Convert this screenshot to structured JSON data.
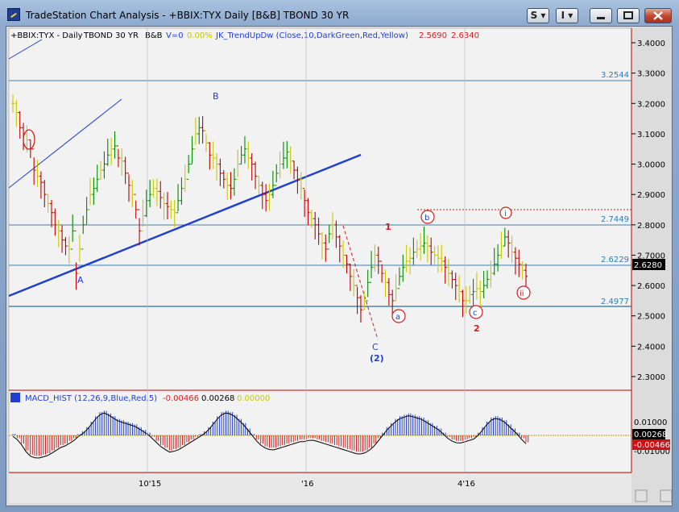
{
  "window": {
    "title": "TradeStation Chart Analysis - +BBIX:TYX Daily [B&B] TBOND 30 YR",
    "btn_s": "S ▾",
    "btn_i": "I ▾",
    "btn_min_icon": "minimize-icon",
    "btn_max_icon": "maximize-icon",
    "btn_close_icon": "close-icon"
  },
  "price_header": {
    "symbol": "+BBIX:TYX - Daily",
    "desc": "TBOND 30 YR",
    "bb": "B&B",
    "volume": "V=0",
    "pct": "0.00%",
    "indicator": "JK_TrendUpDw (Close,10,DarkGreen,Red,Yellow)",
    "val1": "2.5690",
    "val2": "2.6340"
  },
  "macd_header": {
    "name": "MACD_HIST (12,26,9,Blue,Red,5)",
    "val1": "-0.00466",
    "val2": "0.00268",
    "val3": "0.00000"
  },
  "y_axis": {
    "ticks": [
      "3.4000",
      "3.3000",
      "3.2000",
      "3.1000",
      "3.0000",
      "2.9000",
      "2.8000",
      "2.7000",
      "2.6000",
      "2.5000",
      "2.4000",
      "2.3000"
    ],
    "last_price": "2.6280"
  },
  "macd_axis": {
    "ticks": [
      "0.01000",
      "-0.01000"
    ],
    "signal_label": "0.00268",
    "hist_label": "-0.00466"
  },
  "x_axis": {
    "ticks": [
      "10'15",
      "'16",
      "4'16"
    ]
  },
  "levels": [
    "3.2544",
    "2.7449",
    "2.6229",
    "2.4977"
  ],
  "wave_labels": {
    "A": "A",
    "B": "B",
    "C": "C",
    "two_big": "(2)",
    "one": "1",
    "two": "2",
    "a": "a",
    "b": "b",
    "c": "c",
    "i": "i",
    "ii": "ii"
  },
  "chart_data": {
    "type": "ohlc",
    "series": [
      {
        "name": "+BBIX:TYX - Daily",
        "values": [
          3.2,
          3.17,
          3.12,
          3.1,
          3.08,
          3.05,
          2.98,
          2.96,
          2.94,
          2.9,
          2.87,
          2.84,
          2.8,
          2.78,
          2.75,
          2.73,
          2.72,
          2.78,
          2.64,
          2.72,
          2.8,
          2.85,
          2.9,
          2.92,
          2.95,
          2.98,
          3.0,
          3.03,
          3.05,
          3.06,
          3.02,
          3.01,
          2.97,
          2.93,
          2.9,
          2.85,
          2.78,
          2.83,
          2.88,
          2.9,
          2.92,
          2.91,
          2.89,
          2.87,
          2.86,
          2.85,
          2.84,
          2.88,
          2.92,
          2.95,
          3.0,
          3.05,
          3.1,
          3.12,
          3.11,
          3.07,
          3.03,
          3.02,
          3.0,
          2.97,
          2.95,
          2.93,
          2.92,
          2.95,
          3.0,
          3.03,
          3.05,
          3.02,
          3.0,
          2.96,
          2.93,
          2.9,
          2.88,
          2.9,
          2.93,
          2.97,
          3.0,
          3.02,
          3.04,
          3.01,
          2.98,
          2.95,
          2.92,
          2.88,
          2.84,
          2.82,
          2.8,
          2.77,
          2.74,
          2.72,
          2.77,
          2.8,
          2.76,
          2.73,
          2.7,
          2.67,
          2.63,
          2.6,
          2.56,
          2.52,
          2.55,
          2.61,
          2.66,
          2.7,
          2.68,
          2.64,
          2.61,
          2.57,
          2.55,
          2.59,
          2.63,
          2.66,
          2.68,
          2.69,
          2.71,
          2.72,
          2.73,
          2.74,
          2.73,
          2.71,
          2.7,
          2.69,
          2.68,
          2.66,
          2.64,
          2.62,
          2.6,
          2.58,
          2.55,
          2.55,
          2.57,
          2.58,
          2.59,
          2.58,
          2.6,
          2.62,
          2.64,
          2.67,
          2.7,
          2.73,
          2.76,
          2.74,
          2.71,
          2.69,
          2.67,
          2.65,
          2.63
        ]
      },
      {
        "name": "MACD_HIST",
        "values": [
          0.001,
          -0.002,
          -0.006,
          -0.011,
          -0.014,
          -0.015,
          -0.015,
          -0.014,
          -0.013,
          -0.011,
          -0.009,
          -0.007,
          -0.006,
          -0.004,
          -0.002,
          0.001,
          0.003,
          0.006,
          0.01,
          0.014,
          0.017,
          0.018,
          0.016,
          0.014,
          0.012,
          0.011,
          0.01,
          0.009,
          0.008,
          0.006,
          0.004,
          0.002,
          -0.001,
          -0.004,
          -0.007,
          -0.009,
          -0.011,
          -0.01,
          -0.009,
          -0.007,
          -0.005,
          -0.003,
          -0.001,
          0.001,
          0.003,
          0.006,
          0.01,
          0.014,
          0.017,
          0.018,
          0.017,
          0.015,
          0.012,
          0.009,
          0.005,
          0.001,
          -0.003,
          -0.006,
          -0.008,
          -0.009,
          -0.009,
          -0.008,
          -0.007,
          -0.006,
          -0.005,
          -0.004,
          -0.003,
          -0.003,
          -0.002,
          -0.002,
          -0.003,
          -0.004,
          -0.005,
          -0.006,
          -0.007,
          -0.008,
          -0.009,
          -0.01,
          -0.011,
          -0.012,
          -0.012,
          -0.011,
          -0.009,
          -0.006,
          -0.002,
          0.002,
          0.006,
          0.009,
          0.012,
          0.014,
          0.015,
          0.016,
          0.015,
          0.014,
          0.013,
          0.011,
          0.009,
          0.007,
          0.005,
          0.002,
          -0.001,
          -0.003,
          -0.004,
          -0.004,
          -0.003,
          -0.002,
          -0.001,
          0.002,
          0.006,
          0.01,
          0.013,
          0.014,
          0.013,
          0.011,
          0.008,
          0.005,
          0.002,
          -0.002,
          -0.005
        ]
      }
    ]
  }
}
